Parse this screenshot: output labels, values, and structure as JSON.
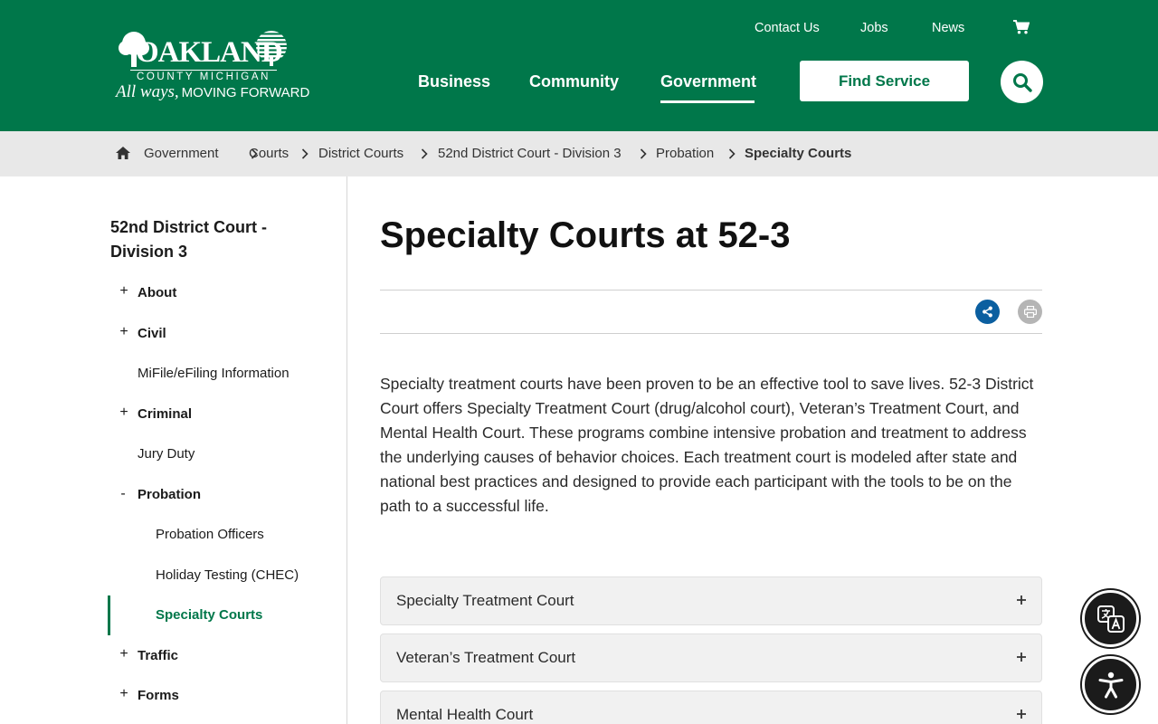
{
  "logo": {
    "word": "OAKLAND",
    "county": "COUNTY MICHIGAN",
    "tagline_script": "All ways,",
    "tagline": "MOVING FORWARD"
  },
  "utility_nav": {
    "contact": "Contact Us",
    "jobs": "Jobs",
    "news": "News"
  },
  "main_nav": {
    "business": "Business",
    "community": "Community",
    "government": "Government",
    "find_service": "Find Service"
  },
  "breadcrumb": {
    "items": [
      "Government",
      "Courts",
      "District Courts",
      "52nd District Court - Division 3",
      "Probation"
    ],
    "current": "Specialty Courts"
  },
  "sidebar": {
    "title": "52nd District Court - Division 3",
    "items": [
      {
        "label": "About",
        "sign": "+"
      },
      {
        "label": "Civil",
        "sign": "+"
      },
      {
        "label": "MiFile/eFiling Information",
        "sign": ""
      },
      {
        "label": "Criminal",
        "sign": "+"
      },
      {
        "label": "Jury Duty",
        "sign": ""
      },
      {
        "label": "Probation",
        "sign": "-"
      },
      {
        "label": "Probation Officers",
        "sign": ""
      },
      {
        "label": "Holiday Testing (CHEC)",
        "sign": ""
      },
      {
        "label": "Specialty Courts",
        "sign": ""
      },
      {
        "label": "Traffic",
        "sign": "+"
      },
      {
        "label": "Forms",
        "sign": "+"
      }
    ]
  },
  "content": {
    "title": "Specialty Courts at 52-3",
    "intro": "Specialty treatment courts have been proven to be an effective tool to save lives. 52-3 District Court offers Specialty Treatment Court (drug/alcohol court), Veteran’s Treatment Court, and Mental Health Court.  These programs combine intensive probation and treatment to address the underlying causes of behavior choices. Each treatment court is modeled after state and national best practices and designed to provide each participant with the tools to be on the path to a successful life.",
    "accordions": [
      "Specialty Treatment Court",
      "Veteran’s Treatment Court",
      "Mental Health Court"
    ]
  },
  "colors": {
    "brand_green": "#00774a",
    "breadcrumb_bg": "#e8e8e8",
    "share_blue": "#0b5fa0"
  },
  "icons": {
    "cart": "cart-icon",
    "search": "search-icon",
    "home": "home-icon",
    "share": "share-icon",
    "print": "print-icon",
    "translate": "translate-icon",
    "accessibility": "accessibility-icon"
  }
}
